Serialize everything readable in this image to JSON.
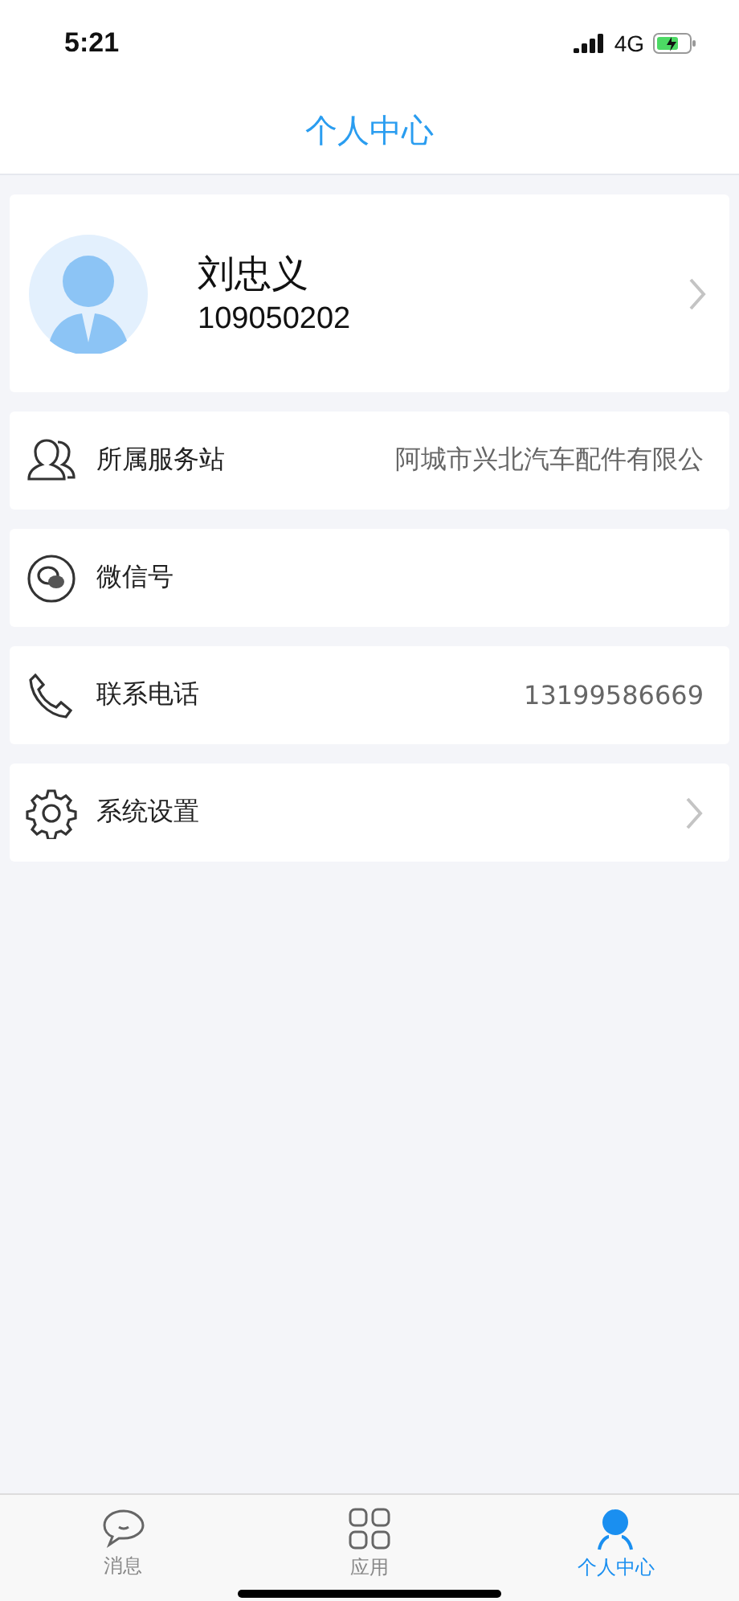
{
  "status_bar": {
    "time": "5:21",
    "network": "4G"
  },
  "header": {
    "title": "个人中心"
  },
  "profile": {
    "name": "刘忠义",
    "id": "109050202"
  },
  "rows": [
    {
      "kind": "people",
      "label": "所属服务站",
      "value": "阿城市兴北汽车配件有限公",
      "chevron": false
    },
    {
      "kind": "wechat",
      "label": "微信号",
      "chevron": false
    },
    {
      "kind": "phone",
      "label": "联系电话",
      "value": "13199586669",
      "chevron": false
    },
    {
      "kind": "gear",
      "label": "系统设置",
      "chevron": true
    }
  ],
  "tabs": [
    {
      "kind": "chat",
      "label": "消息",
      "selected": false
    },
    {
      "kind": "grid",
      "label": "应用",
      "selected": false
    },
    {
      "kind": "person",
      "label": "个人中心",
      "selected": true
    }
  ]
}
